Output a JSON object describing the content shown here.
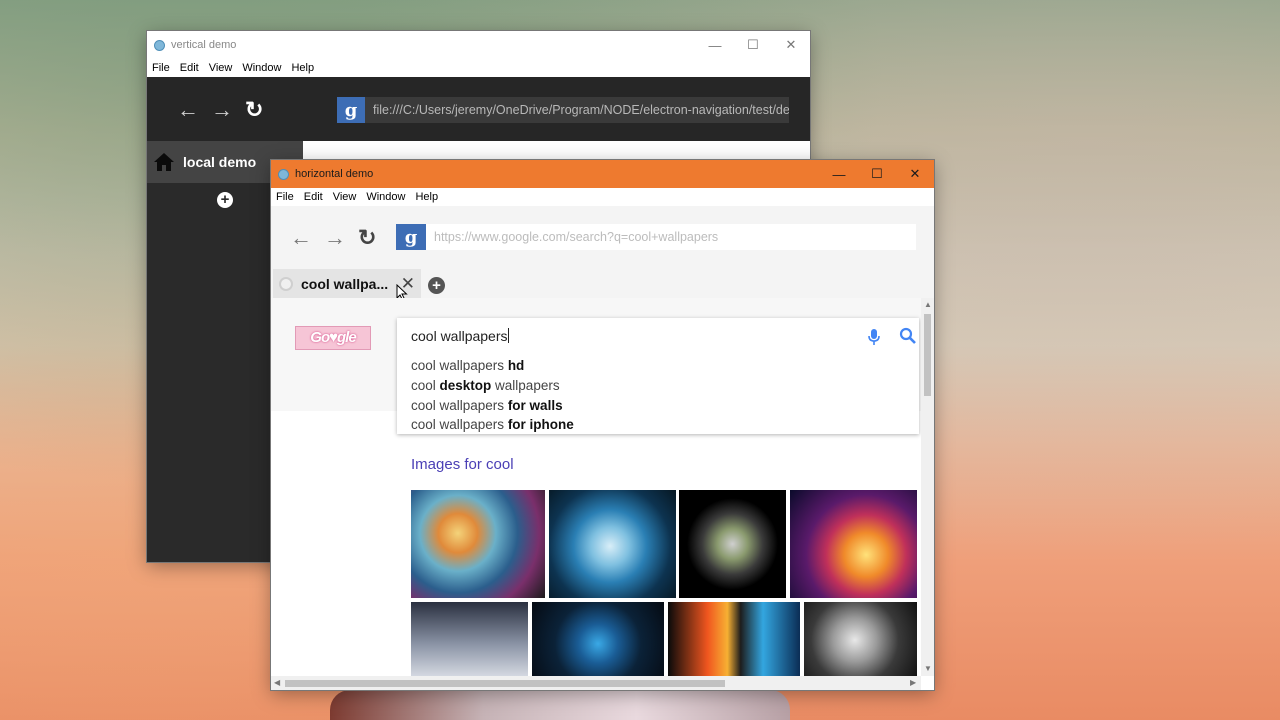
{
  "vertical_window": {
    "title": "vertical demo",
    "menu": [
      "File",
      "Edit",
      "View",
      "Window",
      "Help"
    ],
    "controls": {
      "minimize": "—",
      "maximize": "☐",
      "close": "✕"
    },
    "nav": {
      "back": "←",
      "forward": "→",
      "reload": "↻"
    },
    "address": {
      "engine_icon": "g",
      "url": "file:///C:/Users/jeremy/OneDrive/Program/NODE/electron-navigation/test/dem"
    },
    "tab": {
      "icon": "home-icon",
      "label": "local demo"
    },
    "add_tab": "+"
  },
  "horizontal_window": {
    "title": "horizontal demo",
    "menu": [
      "File",
      "Edit",
      "View",
      "Window",
      "Help"
    ],
    "controls": {
      "minimize": "—",
      "maximize": "☐",
      "close": "✕"
    },
    "nav": {
      "back": "←",
      "forward": "→",
      "reload": "↻"
    },
    "address": {
      "engine_icon": "g",
      "url": "https://www.google.com/search?q=cool+wallpapers"
    },
    "tab": {
      "label": "cool wallpa...",
      "close": "✕"
    },
    "add_tab": "+",
    "google": {
      "doodle_text": "Go♥gle",
      "query": "cool wallpapers",
      "suggestions": [
        {
          "pre": "cool wallpapers ",
          "bold": "hd",
          "post": ""
        },
        {
          "pre": "cool ",
          "bold": "desktop",
          "post": " wallpapers"
        },
        {
          "pre": "cool wallpapers ",
          "bold": "for walls",
          "post": ""
        },
        {
          "pre": "cool wallpapers ",
          "bold": "for iphone",
          "post": ""
        }
      ],
      "images_heading": "Images for cool"
    }
  }
}
